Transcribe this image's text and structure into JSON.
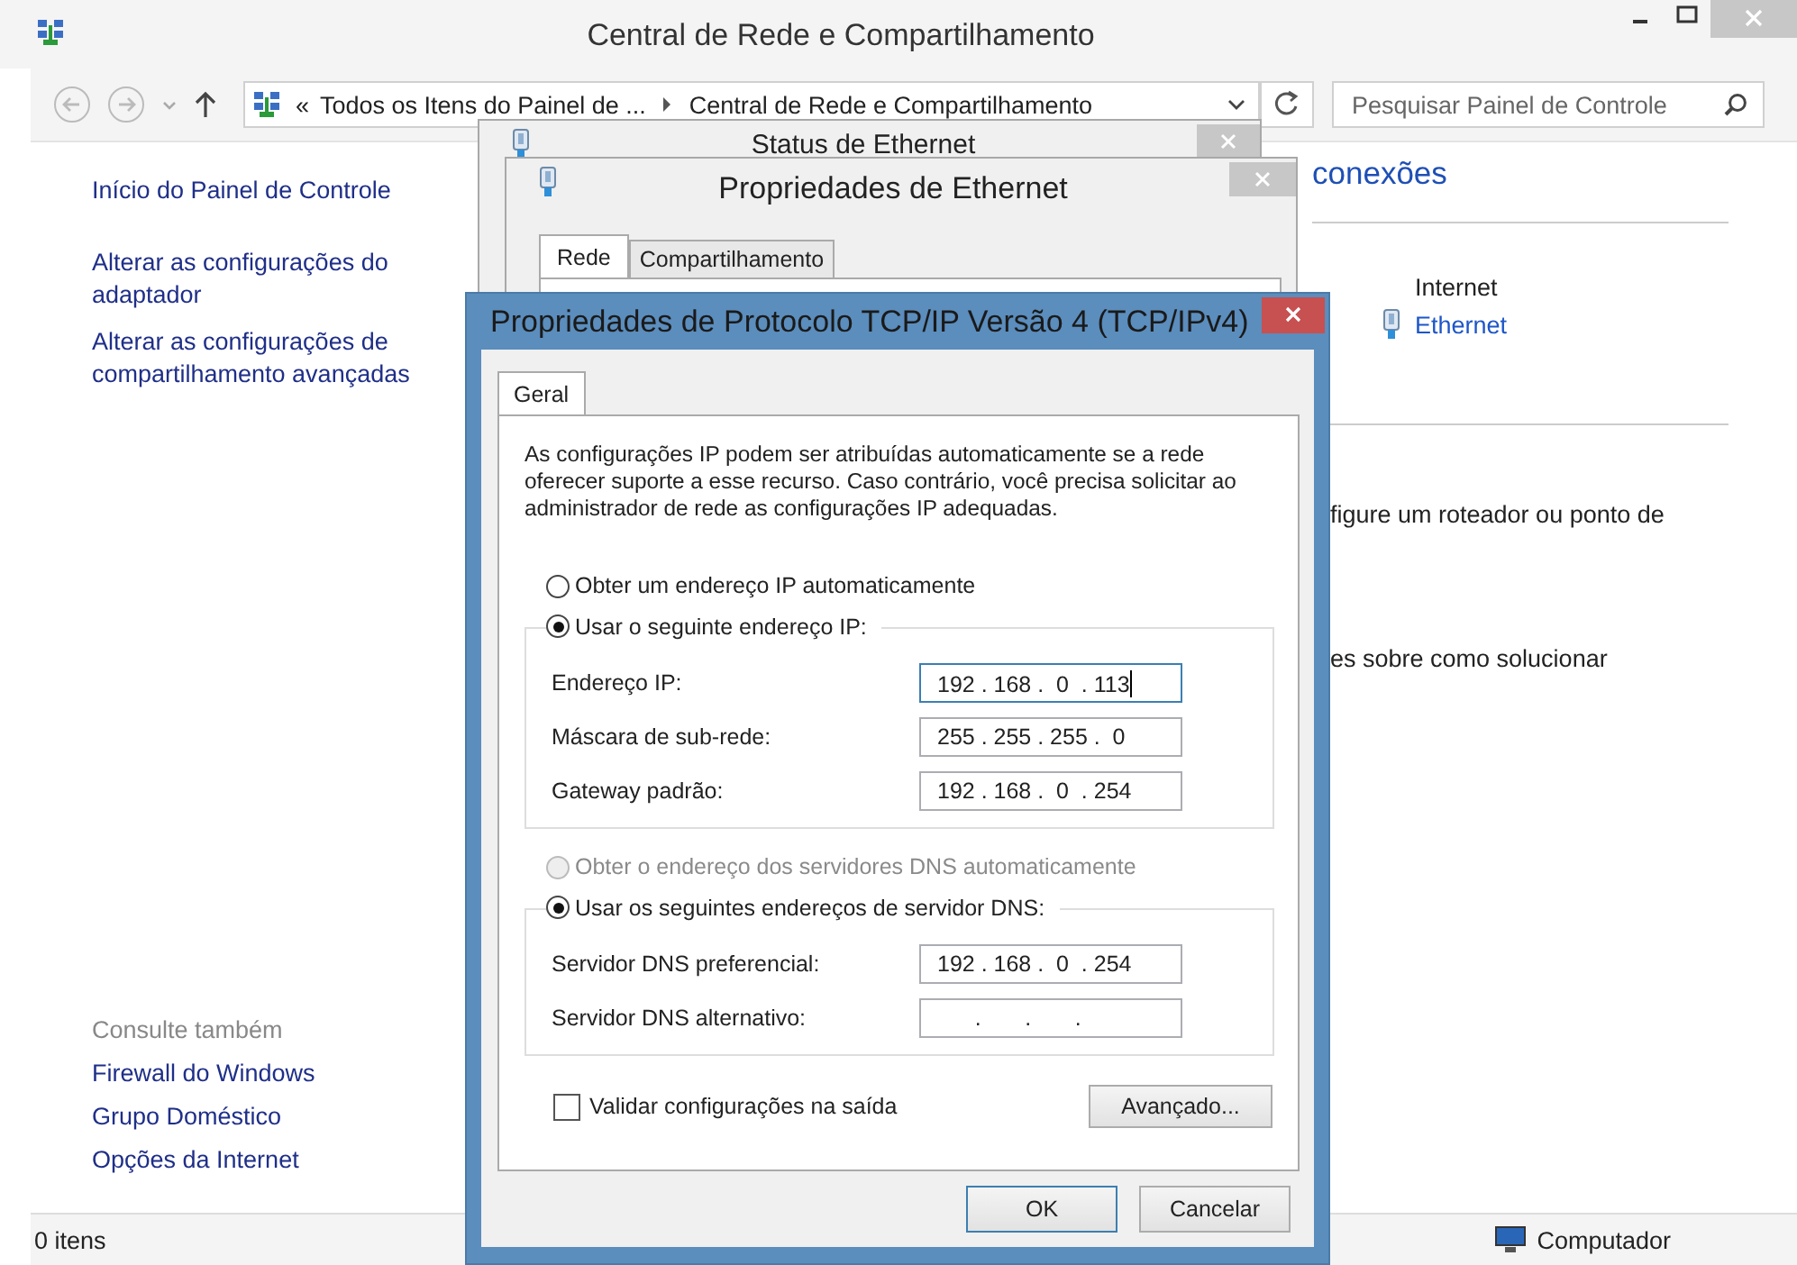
{
  "window": {
    "title": "Central de Rede e Compartilhamento"
  },
  "address_bar": {
    "overflow_mark": "«",
    "segments": [
      "Todos os Itens do Painel de ...",
      "Central de Rede e Compartilhamento"
    ]
  },
  "search": {
    "placeholder": "Pesquisar Painel de Controle"
  },
  "sidebar": {
    "links": [
      "Início do Painel de Controle",
      "Alterar as configurações do adaptador",
      "Alterar as configurações de compartilhamento avançadas"
    ],
    "see_also": {
      "heading": "Consulte também",
      "links": [
        "Firewall do Windows",
        "Grupo Doméstico",
        "Opções da Internet"
      ]
    }
  },
  "content": {
    "heading_fragment": "conexões",
    "network_name": "Internet",
    "connection_link": "Ethernet",
    "text_fragments": [
      "figure um roteador ou ponto de",
      "es sobre como solucionar"
    ]
  },
  "status_bar": {
    "item_count": "0 itens",
    "location": "Computador"
  },
  "status_dialog": {
    "title": "Status de Ethernet"
  },
  "properties_dialog": {
    "title": "Propriedades de Ethernet",
    "tabs": [
      {
        "label": "Rede",
        "selected": true
      },
      {
        "label": "Compartilhamento",
        "selected": false
      }
    ]
  },
  "tcp_dialog": {
    "title": "Propriedades de Protocolo TCP/IP Versão 4 (TCP/IPv4)",
    "tabs": [
      {
        "label": "Geral",
        "selected": true
      }
    ],
    "intro": "As configurações IP podem ser atribuídas automaticamente se a rede oferecer suporte a esse recurso. Caso contrário, você precisa solicitar ao administrador de rede as configurações IP adequadas.",
    "ip_auto": {
      "label": "Obter um endereço IP automaticamente",
      "selected": false,
      "disabled": false
    },
    "ip_manual": {
      "label": "Usar o seguinte endereço IP:",
      "selected": true,
      "disabled": false
    },
    "ip_fields": [
      {
        "label": "Endereço IP:",
        "value": "192 . 168 .  0  . 113",
        "focused": true
      },
      {
        "label": "Máscara de sub-rede:",
        "value": "255 . 255 . 255 .  0",
        "focused": false
      },
      {
        "label": "Gateway padrão:",
        "value": "192 . 168 .  0  . 254",
        "focused": false
      }
    ],
    "dns_auto": {
      "label": "Obter o endereço dos servidores DNS automaticamente",
      "selected": false,
      "disabled": true
    },
    "dns_manual": {
      "label": "Usar os seguintes endereços de servidor DNS:",
      "selected": true,
      "disabled": false
    },
    "dns_fields": [
      {
        "label": "Servidor DNS preferencial:",
        "value": "192 . 168 .  0  . 254",
        "focused": false
      },
      {
        "label": "Servidor DNS alternativo:",
        "value": "      .       .       .",
        "focused": false
      }
    ],
    "validate": {
      "label": "Validar configurações na saída",
      "checked": false
    },
    "advanced_button": "Avançado...",
    "buttons": [
      {
        "label": "OK",
        "default": true
      },
      {
        "label": "Cancelar",
        "default": false
      }
    ]
  }
}
